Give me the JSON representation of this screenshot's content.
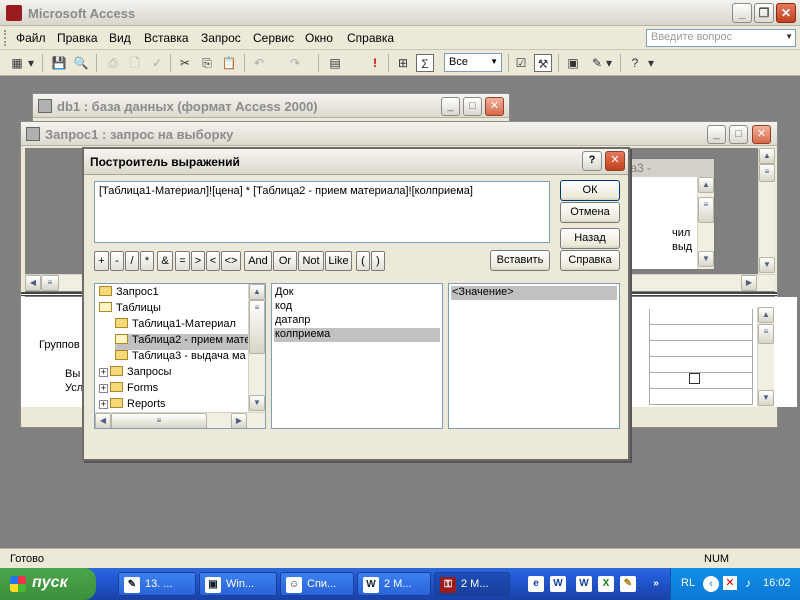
{
  "app": {
    "title": "Microsoft Access"
  },
  "menu": {
    "items": [
      "Файл",
      "Правка",
      "Вид",
      "Вставка",
      "Запрос",
      "Сервис",
      "Окно",
      "Справка"
    ],
    "ask_placeholder": "Введите вопрос"
  },
  "toolbar": {
    "all_value": "Все"
  },
  "db_window": {
    "title": "db1 : база данных (формат Access 2000)"
  },
  "query_window": {
    "title": "Запрос1 : запрос на выборку",
    "table_box_title": "Таблица3 -",
    "table_box_rows": [
      "чил",
      "выд"
    ],
    "grid_labels": [
      "Группов",
      "Вы",
      "Усл"
    ]
  },
  "dialog": {
    "title": "Построитель выражений",
    "expression": "[Таблица1-Материал]![цена] * [Таблица2 - прием материала]![колприема]",
    "buttons": {
      "ok": "ОК",
      "cancel": "Отмена",
      "back": "Назад",
      "insert": "Вставить",
      "help": "Справка"
    },
    "operators": [
      "+",
      "-",
      "/",
      "*",
      "&",
      "=",
      ">",
      "<",
      "<>",
      "And",
      "Or",
      "Not",
      "Like",
      "(",
      ")"
    ],
    "tree": [
      {
        "label": "Запрос1",
        "kind": "folder"
      },
      {
        "label": "Таблицы",
        "kind": "folder-open"
      },
      {
        "label": "Таблица1-Материал",
        "kind": "folder"
      },
      {
        "label": "Таблица2 - прием мате",
        "kind": "folder-open-selected"
      },
      {
        "label": "Таблица3 - выдача ма",
        "kind": "folder"
      },
      {
        "label": "Запросы",
        "kind": "plus"
      },
      {
        "label": "Forms",
        "kind": "plus"
      },
      {
        "label": "Reports",
        "kind": "plus"
      }
    ],
    "fields": [
      "Док",
      "код",
      "датапр",
      "колприема"
    ],
    "selected_field": "колприема",
    "values_header": "<Значение>"
  },
  "status": {
    "left": "Готово",
    "right": "NUM"
  },
  "taskbar": {
    "start_label": "пуск",
    "tasks": [
      "13. ...",
      "Win...",
      "Спи...",
      "2 М...",
      "2 М..."
    ],
    "lang": "RL",
    "time": "16:02"
  },
  "colors": {
    "taskbar_blue": "#245edb",
    "start_green": "#3c8f3c",
    "selection_gray": "#c1c1c1"
  }
}
